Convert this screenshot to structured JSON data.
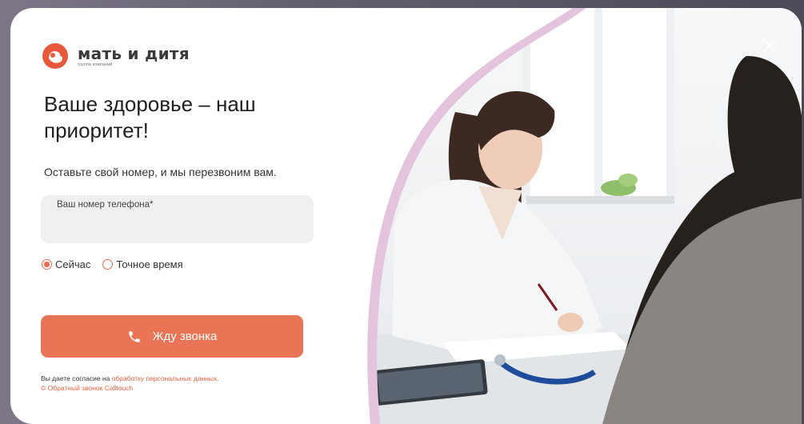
{
  "brand": {
    "name": "мать и дитя",
    "subtitle": "группа компаний",
    "accent_color": "#e97556"
  },
  "modal": {
    "headline": "Ваше здоровье – наш приоритет!",
    "subtext": "Оставьте свой номер, и мы перезвоним вам.",
    "phone_field": {
      "label": "Ваш номер телефона*",
      "value": ""
    },
    "call_time": {
      "selected": "now",
      "options": [
        {
          "id": "now",
          "label": "Сейчас"
        },
        {
          "id": "exact",
          "label": "Точное время"
        }
      ]
    },
    "submit_button": {
      "label": "Жду звонка",
      "icon": "phone-icon"
    },
    "consent": {
      "prefix": "Вы даете согласие на ",
      "link": "обработку персональных данных.",
      "powered_by": "© Обратный звонок Calltouch"
    },
    "close_icon": "close-icon"
  }
}
